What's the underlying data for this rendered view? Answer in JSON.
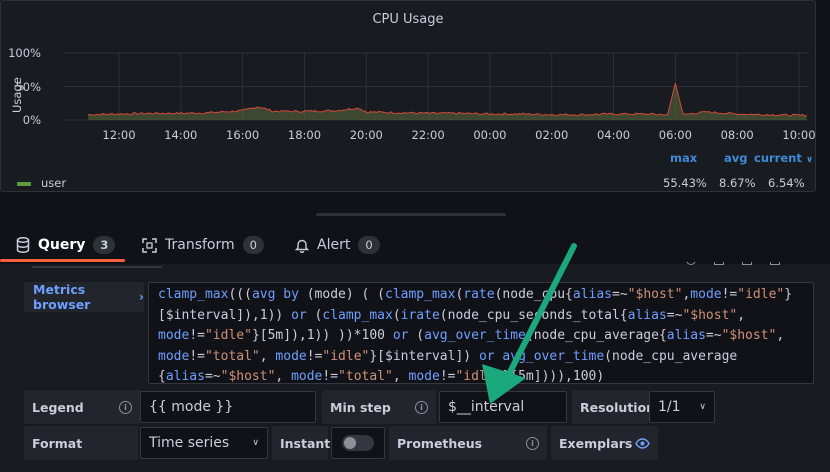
{
  "panel": {
    "title": "CPU Usage",
    "y_axis_title": "Usage",
    "legend_series": "user",
    "legend_headers": {
      "max": "max",
      "avg": "avg",
      "current": "current"
    },
    "legend_values": {
      "max": "55.43%",
      "avg": "8.67%",
      "current": "6.54%"
    }
  },
  "chart_data": {
    "type": "line",
    "title": "CPU Usage",
    "ylabel": "Usage",
    "xlabel": "",
    "x_ticks": [
      "12:00",
      "14:00",
      "16:00",
      "18:00",
      "20:00",
      "22:00",
      "00:00",
      "02:00",
      "04:00",
      "06:00",
      "08:00",
      "10:00"
    ],
    "y_ticks": [
      "0%",
      "50%",
      "100%"
    ],
    "ylim": [
      0,
      100
    ],
    "grid": true,
    "legend_position": "bottom",
    "series": [
      {
        "name": "user",
        "color": "#5e9e3c",
        "x": [
          "11:00",
          "12:00",
          "13:00",
          "14:00",
          "15:00",
          "16:00",
          "16:30",
          "17:00",
          "18:00",
          "19:00",
          "19:45",
          "20:00",
          "21:00",
          "22:00",
          "23:00",
          "00:00",
          "01:00",
          "02:00",
          "03:00",
          "04:00",
          "05:00",
          "05:45",
          "06:00",
          "06:15",
          "07:00",
          "08:00",
          "09:00",
          "10:00",
          "10:15"
        ],
        "y": [
          8,
          9,
          10,
          10,
          11,
          14,
          20,
          13,
          13,
          14,
          18,
          12,
          11,
          10,
          10,
          9,
          9,
          8,
          8,
          9,
          9,
          8,
          55,
          8,
          12,
          9,
          8,
          7,
          7
        ]
      }
    ]
  },
  "tabs": [
    {
      "label": "Query",
      "count": "3",
      "icon": "database-icon"
    },
    {
      "label": "Transform",
      "count": "0",
      "icon": "transform-icon"
    },
    {
      "label": "Alert",
      "count": "0",
      "icon": "bell-icon"
    }
  ],
  "query": {
    "metrics_browser_label": "Metrics browser",
    "expression_lines": [
      "clamp_max(((avg by (mode) ( (clamp_max(rate(node_cpu{alias=~\"$host\",mode!=\"idle\"}",
      "[$interval]),1)) or (clamp_max(irate(node_cpu_seconds_total{alias=~\"$host\",",
      "mode!=\"idle\"}[5m]),1)) ))*100 or (avg_over_time(node_cpu_average{alias=~\"$host\",",
      "mode!=\"total\", mode!=\"idle\"}[$interval]) or avg_over_time(node_cpu_average",
      "{alias=~\"$host\", mode!=\"total\", mode!=\"idle\"}[5m]))),100)"
    ],
    "legend_label": "Legend",
    "legend_value": "{{ mode }}",
    "min_step_label": "Min step",
    "min_step_value": "$__interval",
    "resolution_label": "Resolution",
    "resolution_value": "1/1",
    "format_label": "Format",
    "format_value": "Time series",
    "instant_label": "Instant",
    "prometheus_label": "Prometheus",
    "exemplars_label": "Exemplars"
  },
  "colors": {
    "accent_tab": "#f55f3e",
    "series_line": "#5e9e3c",
    "link_blue": "#6e9fff",
    "arrow": "#1aa87c"
  }
}
